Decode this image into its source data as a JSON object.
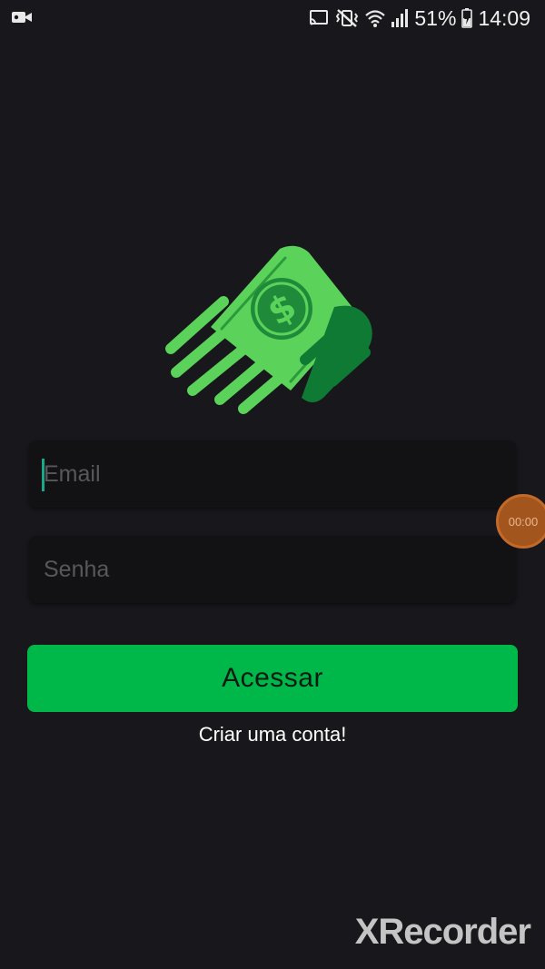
{
  "status_bar": {
    "battery": "51%",
    "time": "14:09"
  },
  "logo": {
    "symbol": "$",
    "colors": {
      "bill_light": "#5bd35a",
      "bill_dark": "#0e7a34",
      "coin": "#1f8a3a"
    }
  },
  "form": {
    "email_placeholder": "Email",
    "password_placeholder": "Senha"
  },
  "recorder": {
    "timer": "00:00"
  },
  "actions": {
    "access_label": "Acessar",
    "create_account_label": "Criar uma conta!",
    "accent_color": "#00b84a"
  },
  "watermark": {
    "text": "XRecorder"
  }
}
